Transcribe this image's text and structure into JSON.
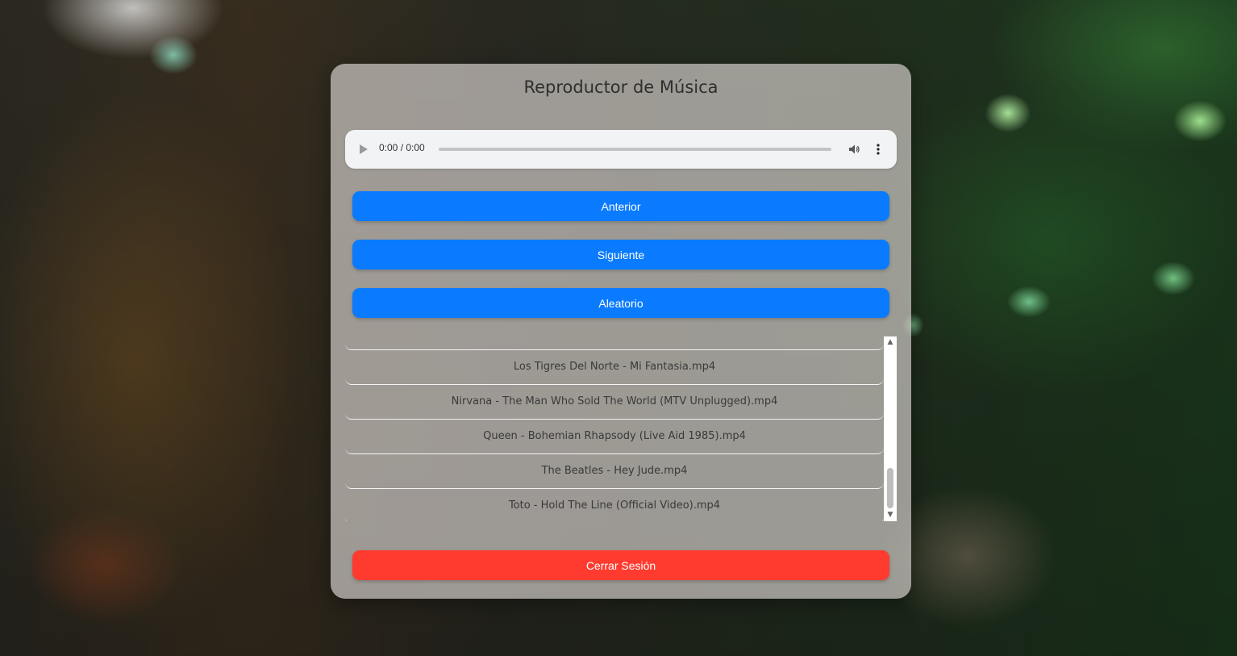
{
  "app": {
    "title": "Reproductor de Música"
  },
  "player": {
    "time": "0:00 / 0:00",
    "play_icon": "play-icon",
    "volume_icon": "volume-icon",
    "menu_icon": "more-vert-icon"
  },
  "controls": {
    "prev_label": "Anterior",
    "next_label": "Siguiente",
    "shuffle_label": "Aleatorio",
    "logout_label": "Cerrar Sesión"
  },
  "playlist": {
    "items": [
      "",
      "Los Tigres Del Norte - Mi Fantasia.mp4",
      "Nirvana - The Man Who Sold The World (MTV Unplugged).mp4",
      "Queen - Bohemian Rhapsody (Live Aid 1985).mp4",
      "The Beatles - Hey Jude.mp4",
      "Toto - Hold The Line (Official Video).mp4"
    ]
  },
  "colors": {
    "primary": "#0a7bff",
    "danger": "#ff3b30"
  }
}
